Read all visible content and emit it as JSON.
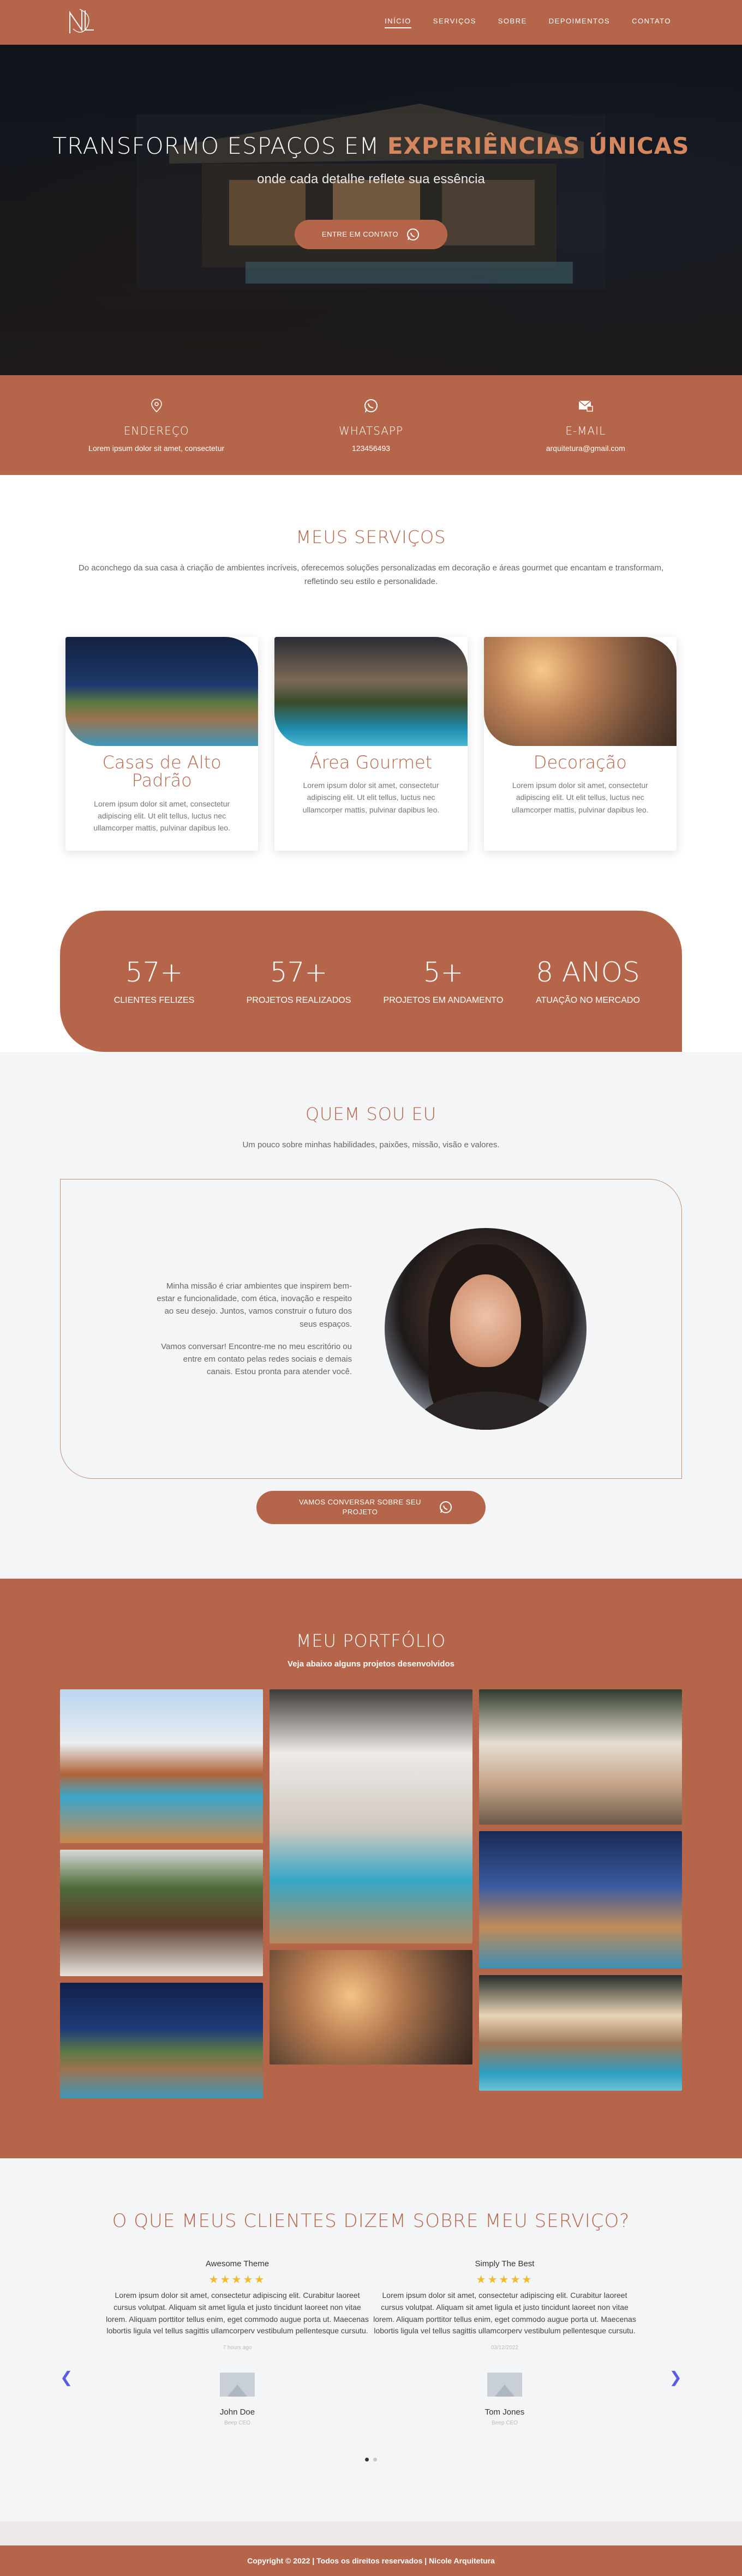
{
  "brand": {
    "logo_text": "NL",
    "primary_color": "#b5664a"
  },
  "nav": {
    "items": [
      "INÍCIO",
      "SERVIÇOS",
      "SOBRE",
      "DEPOIMENTOS",
      "CONTATO"
    ],
    "active": "INÍCIO"
  },
  "hero": {
    "title_main": "TRANSFORMO ESPAÇOS EM",
    "title_accent": "EXPERIÊNCIAS ÚNICAS",
    "subtitle": "onde cada detalhe reflete sua essência",
    "cta_label": "ENTRE EM CONTATO"
  },
  "contact": [
    {
      "icon": "location-pin-icon",
      "label": "ENDEREÇO",
      "value": "Lorem ipsum dolor sit amet, consectetur"
    },
    {
      "icon": "whatsapp-icon",
      "label": "WHATSAPP",
      "value": "123456493"
    },
    {
      "icon": "email-icon",
      "label": "E-MAIL",
      "value": "arquitetura@gmail.com"
    }
  ],
  "services": {
    "title": "MEUS SERVIÇOS",
    "subtitle": "Do aconchego da sua casa à criação de ambientes incríveis, oferecemos soluções personalizadas em decoração e áreas gourmet que encantam e transformam, refletindo seu estilo e personalidade.",
    "cards": [
      {
        "title": "Casas de Alto Padrão",
        "text": "Lorem ipsum dolor sit amet, consectetur adipiscing elit. Ut elit tellus, luctus nec ullamcorper mattis, pulvinar dapibus leo."
      },
      {
        "title": "Área Gourmet",
        "text": "Lorem ipsum dolor sit amet, consectetur adipiscing elit. Ut elit tellus, luctus nec ullamcorper mattis, pulvinar dapibus leo."
      },
      {
        "title": "Decoração",
        "text": "Lorem ipsum dolor sit amet, consectetur adipiscing elit. Ut elit tellus, luctus nec ullamcorper mattis, pulvinar dapibus leo."
      }
    ]
  },
  "stats": [
    {
      "num": "57+",
      "label": "CLIENTES FELIZES"
    },
    {
      "num": "57+",
      "label": "PROJETOS REALIZADOS"
    },
    {
      "num": "5+",
      "label": "PROJETOS EM ANDAMENTO"
    },
    {
      "num": "8 ANOS",
      "label": "ATUAÇÃO NO MERCADO"
    }
  ],
  "about": {
    "title": "QUEM SOU EU",
    "subtitle": "Um pouco sobre minhas habilidades, paixões, missão, visão e valores.",
    "p1": "Minha missão é criar ambientes que inspirem bem-estar e funcionalidade, com ética, inovação e respeito ao seu desejo. Juntos, vamos construir o futuro dos seus espaços.",
    "p2": "Vamos conversar! Encontre-me no meu escritório ou entre em contato pelas redes sociais e demais canais. Estou pronta para atender você.",
    "cta_label": "VAMOS CONVERSAR SOBRE SEU PROJETO"
  },
  "portfolio": {
    "title": "MEU PORTFÓLIO",
    "subtitle": "Veja abaixo alguns projetos desenvolvidos"
  },
  "testimonials": {
    "title": "O QUE MEUS CLIENTES DIZEM SOBRE MEU SERVIÇO?",
    "items": [
      {
        "heading": "Awesome Theme",
        "stars": "★★★★★",
        "text": "Lorem ipsum dolor sit amet, consectetur adipiscing elit. Curabitur laoreet cursus volutpat. Aliquam sit amet ligula et justo tincidunt laoreet non vitae lorem. Aliquam porttitor tellus enim, eget commodo augue porta ut. Maecenas lobortis ligula vel tellus sagittis ullamcorperv vestibulum pellentesque cursutu.",
        "date": "7 hours ago",
        "name": "John Doe",
        "role": "Beep CEO"
      },
      {
        "heading": "Simply The Best",
        "stars": "★★★★★",
        "text": "Lorem ipsum dolor sit amet, consectetur adipiscing elit. Curabitur laoreet cursus volutpat. Aliquam sit amet ligula et justo tincidunt laoreet non vitae lorem. Aliquam porttitor tellus enim, eget commodo augue porta ut. Maecenas lobortis ligula vel tellus sagittis ullamcorperv vestibulum pellentesque cursutu.",
        "date": "03/12/2022",
        "name": "Tom Jones",
        "role": "Beep CEO"
      }
    ]
  },
  "footer": {
    "text": "Copyright © 2022 | Todos os direitos reservados | Nicole Arquitetura"
  }
}
